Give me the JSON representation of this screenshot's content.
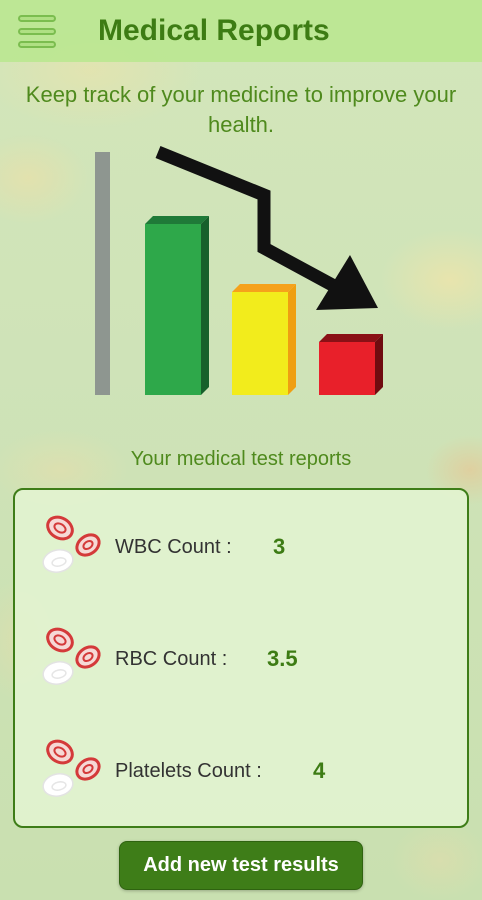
{
  "header": {
    "title": "Medical Reports",
    "menu_icon": "hamburger-menu-icon"
  },
  "tagline": "Keep track of your medicine to improve your health.",
  "illustration": {
    "icon": "declining-bar-chart-icon",
    "bar_colors": [
      "#2ea84a",
      "#f2ec1c",
      "#e8202a"
    ],
    "axis_color": "#8e9690",
    "arrow_color": "#111111"
  },
  "section_label": "Your medical test reports",
  "reports": [
    {
      "label": "WBC Count :",
      "value": "3",
      "icon": "blood-cells-icon"
    },
    {
      "label": "RBC Count :",
      "value": "3.5",
      "icon": "blood-cells-icon"
    },
    {
      "label": "Platelets Count :",
      "value": "4",
      "icon": "blood-cells-icon"
    }
  ],
  "add_button": {
    "label": "Add new test results"
  },
  "colors": {
    "accent": "#3e7d18",
    "title_green": "#3d7c14",
    "header_bg": "#bbe791"
  }
}
